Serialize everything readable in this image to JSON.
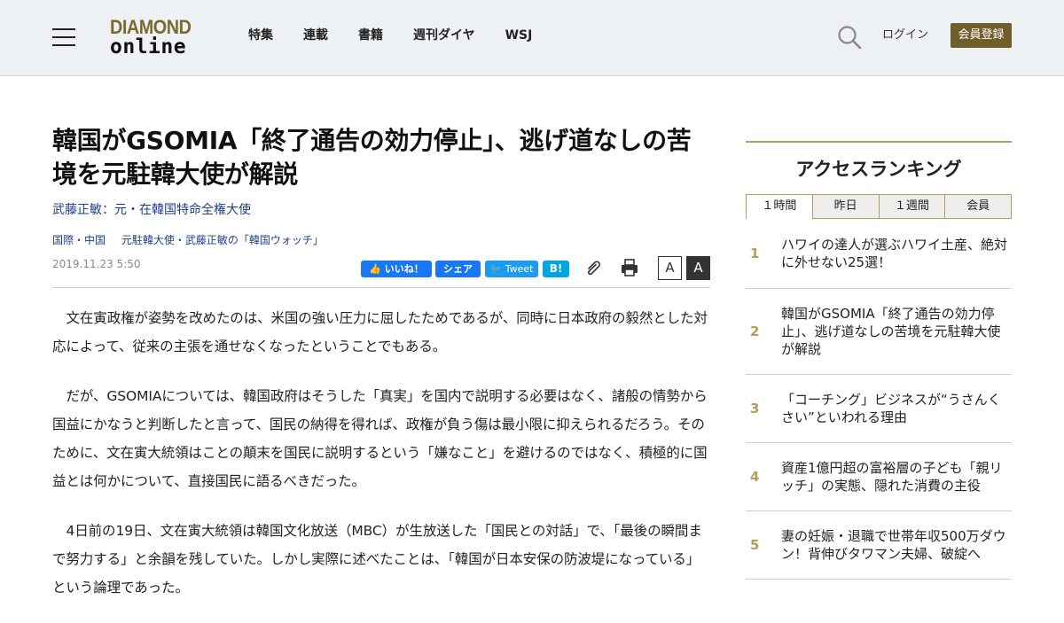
{
  "header": {
    "logo_top": "DIAMOND",
    "logo_bottom": "online",
    "nav": [
      "特集",
      "連載",
      "書籍",
      "週刊ダイヤ",
      "WSJ"
    ],
    "login": "ログイン",
    "register": "会員登録"
  },
  "article": {
    "title": "韓国がGSOMIA「終了通告の効力停止」、逃げ道なしの苦境を元駐韓大使が解説",
    "author": "武藤正敏：元・在韓国特命全権大使",
    "categories": [
      "国際・中国",
      "元駐韓大使・武藤正敏の「韓国ウォッチ」"
    ],
    "date": "2019.11.23 5:50",
    "share": {
      "fb_like": "いいね！",
      "fb_share": "シェア",
      "tweet": "Tweet",
      "hatena": "B!"
    },
    "font_small": "A",
    "font_large": "A",
    "paragraphs": [
      "文在寅政権が姿勢を改めたのは、米国の強い圧力に屈したためであるが、同時に日本政府の毅然とした対応によって、従来の主張を通せなくなったということでもある。",
      "だが、GSOMIAについては、韓国政府はそうした「真実」を国内で説明する必要はなく、諸般の情勢から国益にかなうと判断したと言って、国民の納得を得れば、政権が負う傷は最小限に抑えられるだろう。そのために、文在寅大統領はことの顛末を国民に説明するという「嫌なこと」を避けるのではなく、積極的に国益とは何かについて、直接国民に語るべきだった。",
      "4日前の19日、文在寅大統領は韓国文化放送（MBC）が生放送した「国民との対話」で、「最後の瞬間まで努力する」と余韻を残していた。しかし実際に述べたことは、「韓国が日本安保の防波堤になっている」という論理であった。"
    ]
  },
  "ranking": {
    "title": "アクセスランキング",
    "tabs": [
      "１時間",
      "昨日",
      "１週間",
      "会員"
    ],
    "items": [
      {
        "rank": "1",
        "text": "ハワイの達人が選ぶハワイ土産、絶対に外せない25選！"
      },
      {
        "rank": "2",
        "text": "韓国がGSOMIA「終了通告の効力停止」、逃げ道なしの苦境を元駐韓大使が解説"
      },
      {
        "rank": "3",
        "text": "「コーチング」ビジネスが“うさんくさい”といわれる理由"
      },
      {
        "rank": "4",
        "text": "資産1億円超の富裕層の子ども「親リッチ」の実態、隠れた消費の主役"
      },
      {
        "rank": "5",
        "text": "妻の妊娠・退職で世帯年収500万ダウン！背伸びタワマン夫婦、破綻へ"
      }
    ]
  }
}
